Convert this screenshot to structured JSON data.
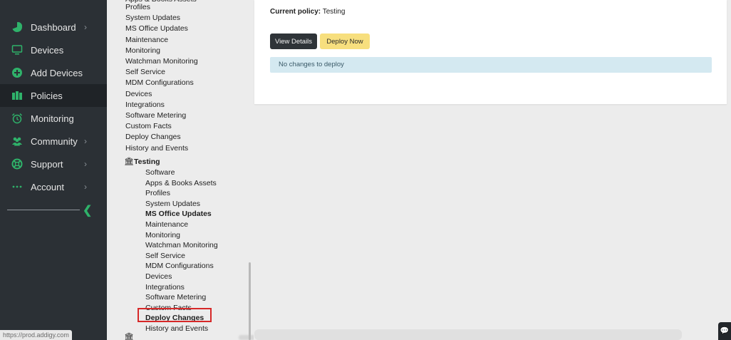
{
  "sidebar": {
    "items": [
      {
        "label": "Dashboard",
        "icon": "pie-chart-icon",
        "has_chevron": true
      },
      {
        "label": "Devices",
        "icon": "monitor-icon",
        "has_chevron": false
      },
      {
        "label": "Add Devices",
        "icon": "plus-circle-icon",
        "has_chevron": false
      },
      {
        "label": "Policies",
        "icon": "policies-icon",
        "has_chevron": false,
        "active": true
      },
      {
        "label": "Monitoring",
        "icon": "alarm-clock-icon",
        "has_chevron": false
      },
      {
        "label": "Community",
        "icon": "users-icon",
        "has_chevron": true
      },
      {
        "label": "Support",
        "icon": "lifebuoy-icon",
        "has_chevron": true
      },
      {
        "label": "Account",
        "icon": "ellipsis-icon",
        "has_chevron": true
      }
    ],
    "accent_color": "#2fb26a",
    "status_url": "https://prod.addigy.com"
  },
  "tree": {
    "top_cut_label": "Apps & Books Assets",
    "upper_items": [
      "Profiles",
      "System Updates",
      "MS Office Updates",
      "Maintenance",
      "Monitoring",
      "Watchman Monitoring",
      "Self Service",
      "MDM Configurations",
      "Devices",
      "Integrations",
      "Software Metering",
      "Custom Facts",
      "Deploy Changes",
      "History and Events"
    ],
    "group_label": "Testing",
    "group_items": [
      "Software",
      "Apps & Books Assets",
      "Profiles",
      "System Updates",
      "MS Office Updates",
      "Maintenance",
      "Monitoring",
      "Watchman Monitoring",
      "Self Service",
      "MDM Configurations",
      "Devices",
      "Integrations",
      "Software Metering",
      "Custom Facts",
      "Deploy Changes",
      "History and Events"
    ]
  },
  "main": {
    "current_policy_label": "Current policy:",
    "current_policy_value": "Testing",
    "view_details_label": "View Details",
    "deploy_now_label": "Deploy Now",
    "no_changes_message": "No changes to deploy"
  }
}
